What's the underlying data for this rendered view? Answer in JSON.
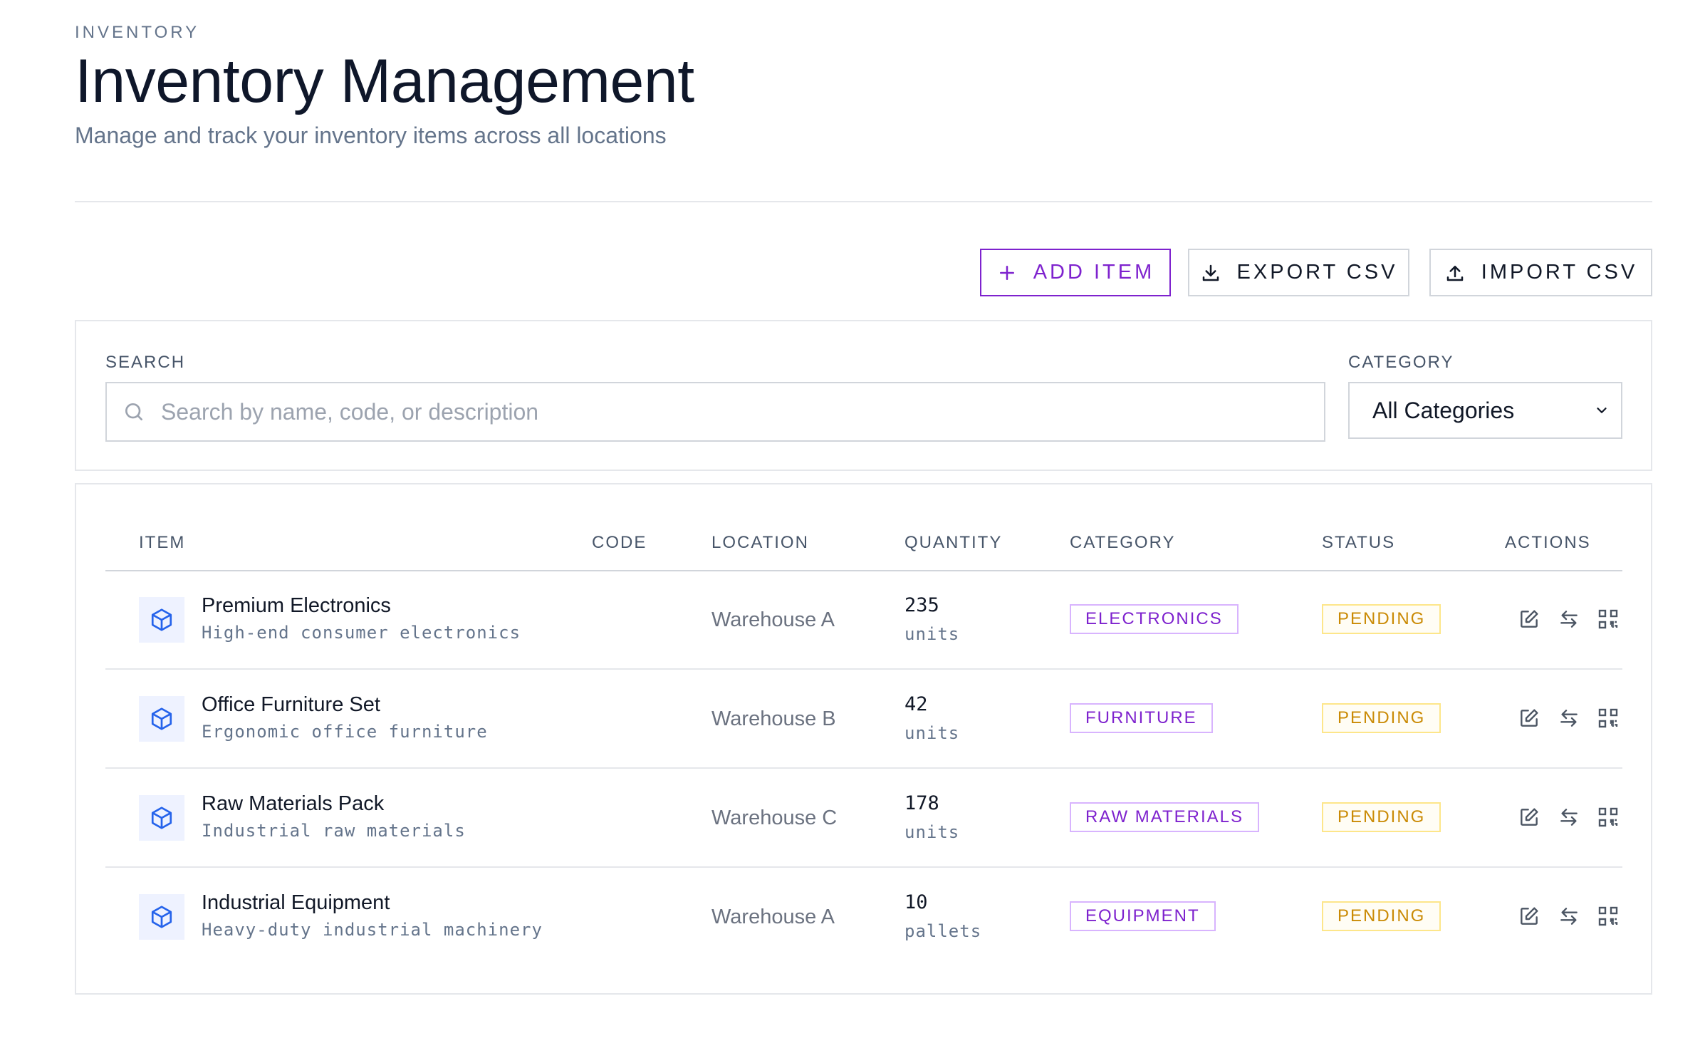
{
  "header": {
    "eyebrow": "INVENTORY",
    "title": "Inventory Management",
    "subtitle": "Manage and track your inventory items across all locations"
  },
  "toolbar": {
    "add_label": "ADD ITEM",
    "export_label": "EXPORT CSV",
    "import_label": "IMPORT CSV"
  },
  "filters": {
    "search_label": "SEARCH",
    "search_placeholder": "Search by name, code, or description",
    "category_label": "CATEGORY",
    "category_value": "All Categories"
  },
  "table": {
    "columns": [
      "ITEM",
      "CODE",
      "LOCATION",
      "QUANTITY",
      "CATEGORY",
      "STATUS",
      "ACTIONS"
    ],
    "rows": [
      {
        "name": "Premium Electronics",
        "description": "High-end consumer electronics",
        "code": "",
        "location": "Warehouse A",
        "quantity": "235",
        "unit": "units",
        "category": "ELECTRONICS",
        "status": "PENDING"
      },
      {
        "name": "Office Furniture Set",
        "description": "Ergonomic office furniture",
        "code": "",
        "location": "Warehouse B",
        "quantity": "42",
        "unit": "units",
        "category": "FURNITURE",
        "status": "PENDING"
      },
      {
        "name": "Raw Materials Pack",
        "description": "Industrial raw materials",
        "code": "",
        "location": "Warehouse C",
        "quantity": "178",
        "unit": "units",
        "category": "RAW MATERIALS",
        "status": "PENDING"
      },
      {
        "name": "Industrial Equipment",
        "description": "Heavy-duty industrial machinery",
        "code": "",
        "location": "Warehouse A",
        "quantity": "10",
        "unit": "pallets",
        "category": "EQUIPMENT",
        "status": "PENDING"
      }
    ]
  },
  "colors": {
    "accent": "#7e22ce",
    "status_pending": "#ca8a04",
    "icon_blue": "#2563eb"
  },
  "icons": {
    "add": "plus-icon",
    "export": "download-icon",
    "import": "upload-icon",
    "search": "search-icon",
    "select": "chevron-down-icon",
    "item": "box-icon",
    "edit": "edit-icon",
    "transfer": "transfer-icon",
    "qr": "qr-code-icon"
  }
}
